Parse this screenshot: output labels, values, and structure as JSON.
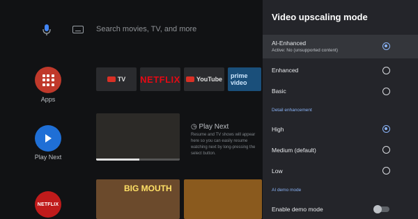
{
  "home": {
    "search_placeholder": "Search movies, TV, and more",
    "sidebar_apps_label": "Apps",
    "sidebar_play_next_label": "Play Next",
    "sidebar_netflix_label": "NETFLIX",
    "tiles": {
      "youtube_tv": "TV",
      "netflix": "NETFLIX",
      "youtube": "YouTube",
      "prime_video": "prime video"
    },
    "play_next": {
      "title": "Play Next",
      "description": "Resume and TV shows will appear here so you can easily resume watching next by long-pressing the select button."
    },
    "thumb_title": "BIG MOUTH"
  },
  "panel": {
    "title": "Video upscaling mode",
    "options": [
      {
        "label": "AI-Enhanced",
        "sublabel": "Active: No (unsupported content)",
        "selected": true
      },
      {
        "label": "Enhanced",
        "selected": false
      },
      {
        "label": "Basic",
        "selected": false
      }
    ],
    "detail_section": "Detail enhancement",
    "detail_options": [
      {
        "label": "High",
        "selected": true
      },
      {
        "label": "Medium (default)",
        "selected": false
      },
      {
        "label": "Low",
        "selected": false
      }
    ],
    "demo_section": "AI demo mode",
    "demo_label": "Enable demo mode",
    "demo_enabled": false
  },
  "colors": {
    "panel_bg": "#24252a",
    "accent": "#8ab4f8",
    "apps_red": "#c0392b",
    "play_blue": "#1f6fd6"
  }
}
